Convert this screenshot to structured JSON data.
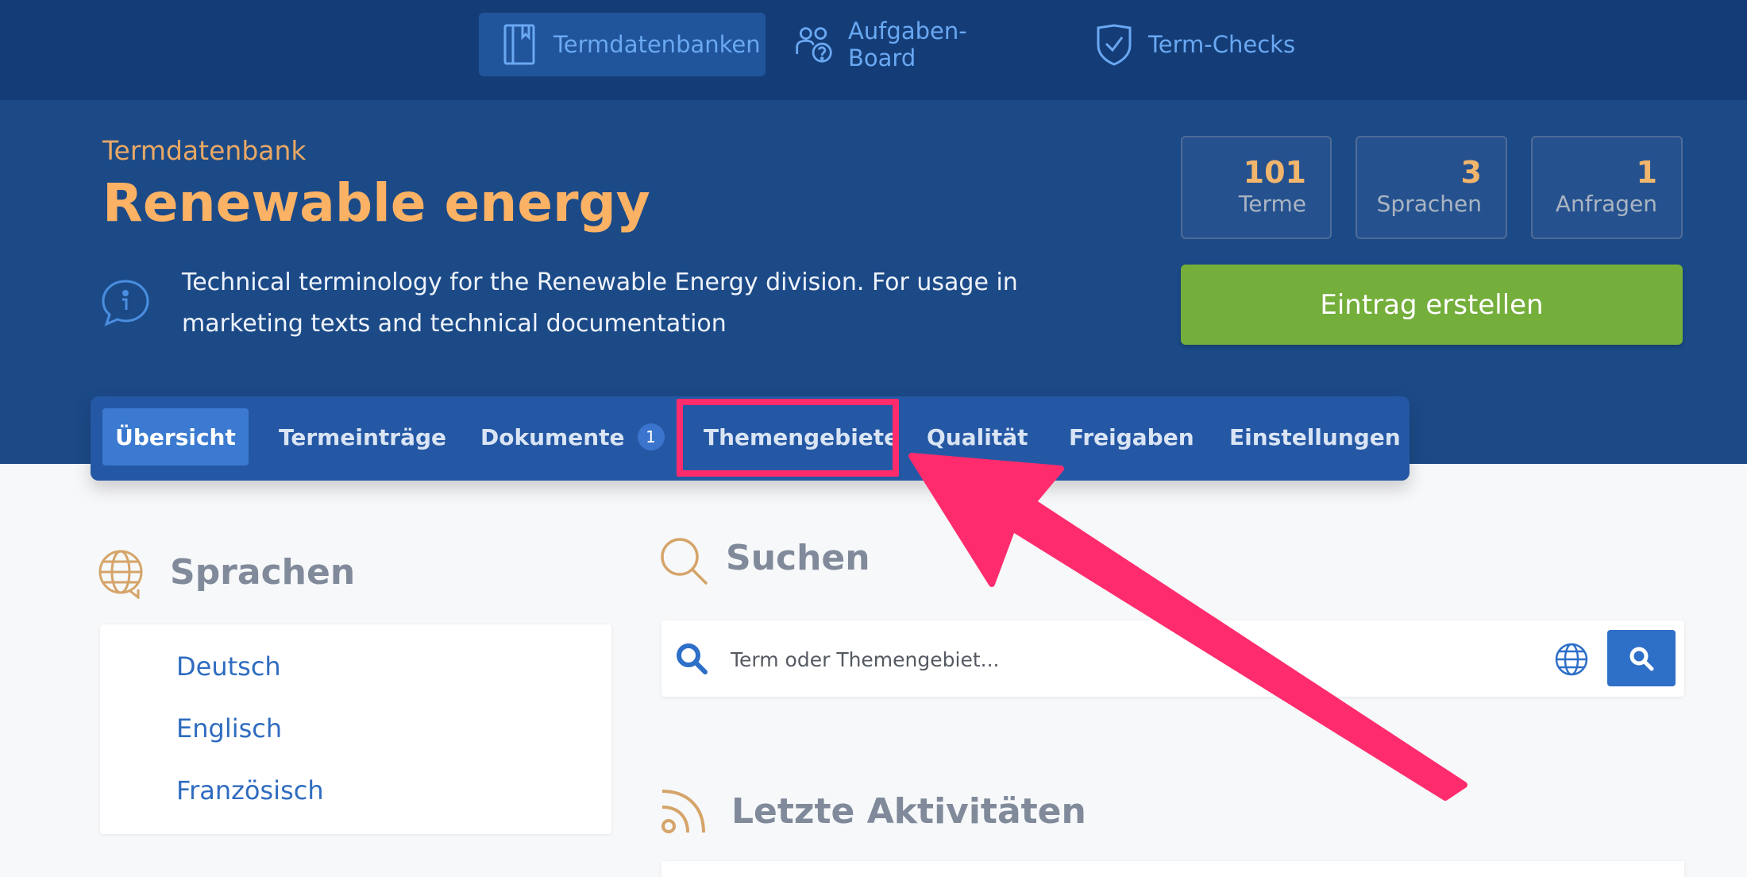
{
  "topnav": {
    "items": [
      {
        "label": "Termdatenbanken",
        "icon": "book-icon"
      },
      {
        "label": "Aufgaben-Board",
        "icon": "users-question-icon"
      },
      {
        "label": "Term-Checks",
        "icon": "shield-check-icon"
      }
    ],
    "active_color": "#21559b",
    "text_color": "#6aa8f2"
  },
  "header": {
    "eyebrow": "Termdatenbank",
    "title": "Renewable energy",
    "description": "Technical terminology for the Renewable Energy division. For usage in marketing texts and technical documentation"
  },
  "stats": [
    {
      "value": "101",
      "label": "Terme"
    },
    {
      "value": "3",
      "label": "Sprachen"
    },
    {
      "value": "1",
      "label": "Anfragen"
    }
  ],
  "cta": {
    "label": "Eintrag erstellen",
    "color": "#74ae3b"
  },
  "tabs": [
    {
      "label": "Übersicht"
    },
    {
      "label": "Termeinträge"
    },
    {
      "label": "Dokumente",
      "badge": "1"
    },
    {
      "label": "Themengebiete"
    },
    {
      "label": "Qualität"
    },
    {
      "label": "Freigaben"
    },
    {
      "label": "Einstellungen"
    }
  ],
  "languages": {
    "title": "Sprachen",
    "items": [
      "Deutsch",
      "Englisch",
      "Französisch"
    ]
  },
  "search": {
    "title": "Suchen",
    "placeholder": "Term oder Themengebiet..."
  },
  "activity": {
    "title": "Letzte Aktivitäten"
  },
  "annotation": {
    "color": "#ff2c6d"
  }
}
